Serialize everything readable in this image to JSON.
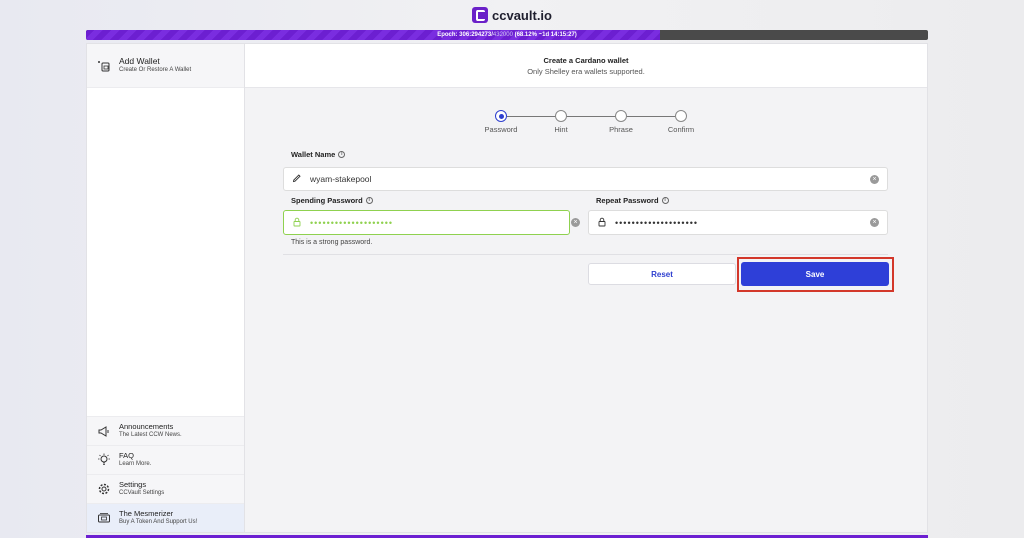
{
  "app": {
    "title": "ccvault.io"
  },
  "epoch": {
    "prefix": "Epoch: 306:294273/",
    "total": "432000",
    "suffix": " (68.12% ~1d 14:15:27)",
    "progress_fraction": 0.6812
  },
  "sidebar": {
    "add_wallet": {
      "title": "Add Wallet",
      "subtitle": "Create Or Restore A Wallet"
    },
    "items": [
      {
        "title": "Announcements",
        "subtitle": "The Latest CCW News.",
        "icon": "megaphone-icon"
      },
      {
        "title": "FAQ",
        "subtitle": "Learn More.",
        "icon": "lightbulb-icon"
      },
      {
        "title": "Settings",
        "subtitle": "CCVault Settings",
        "icon": "gear-icon"
      },
      {
        "title": "The Mesmerizer",
        "subtitle": "Buy A Token And Support Us!",
        "icon": "ticket-icon"
      }
    ]
  },
  "header": {
    "title": "Create a Cardano wallet",
    "subtitle": "Only Shelley era wallets supported."
  },
  "steps": [
    "Password",
    "Hint",
    "Phrase",
    "Confirm"
  ],
  "form": {
    "wallet_name_label": "Wallet Name",
    "wallet_name_value": "wyam-stakepool",
    "spending_password_label": "Spending Password",
    "spending_password_value": "••••••••••••••••••••",
    "repeat_password_label": "Repeat Password",
    "repeat_password_value": "••••••••••••••••••••",
    "password_hint": "This is a strong password."
  },
  "buttons": {
    "reset": "Reset",
    "save": "Save"
  },
  "colors": {
    "accent": "#2e3fd8",
    "brand": "#6c1fd1",
    "success": "#8fd14f",
    "highlight": "#d3372a"
  }
}
